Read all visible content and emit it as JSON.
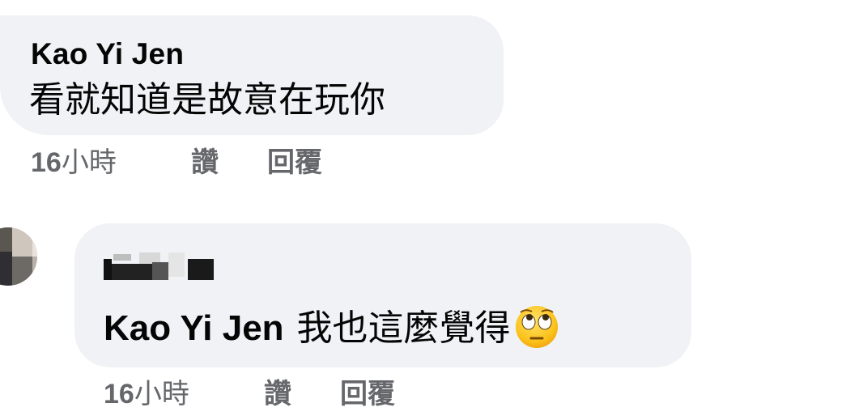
{
  "comments": [
    {
      "author": "Kao Yi Jen",
      "text": "看就知道是故意在玩你",
      "time_value": "16",
      "time_unit": "小時",
      "like_label": "讚",
      "reply_label": "回覆"
    },
    {
      "author": "",
      "mention": "Kao Yi Jen",
      "text": "我也這麼覺得",
      "emoji": "face-with-rolling-eyes",
      "time_value": "16",
      "time_unit": "小時",
      "like_label": "讚",
      "reply_label": "回覆"
    }
  ],
  "colors": {
    "bubble": "#f0f2f5",
    "text": "#050505",
    "meta": "#65676b"
  }
}
